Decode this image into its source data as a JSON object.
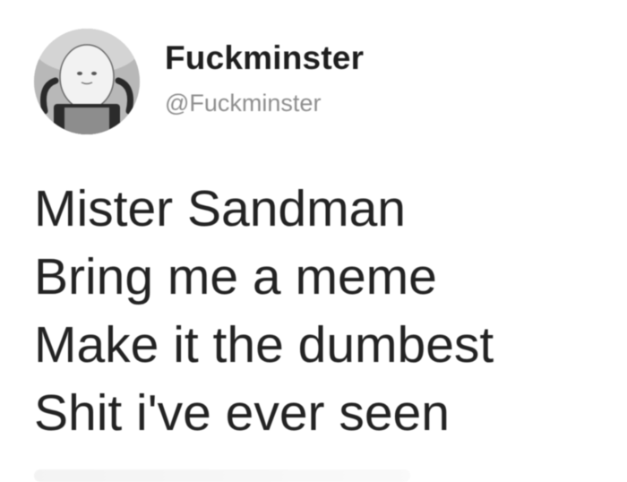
{
  "user": {
    "display_name": "Fuckminster",
    "handle": "@Fuckminster",
    "avatar_icon": "egghead-character-avatar"
  },
  "tweet": {
    "lines": [
      "Mister Sandman",
      "Bring me a meme",
      "Make it the dumbest",
      "Shit i've ever seen"
    ]
  },
  "colors": {
    "background": "#ffffff",
    "text": "#222222",
    "handle": "#8e8e8e"
  }
}
